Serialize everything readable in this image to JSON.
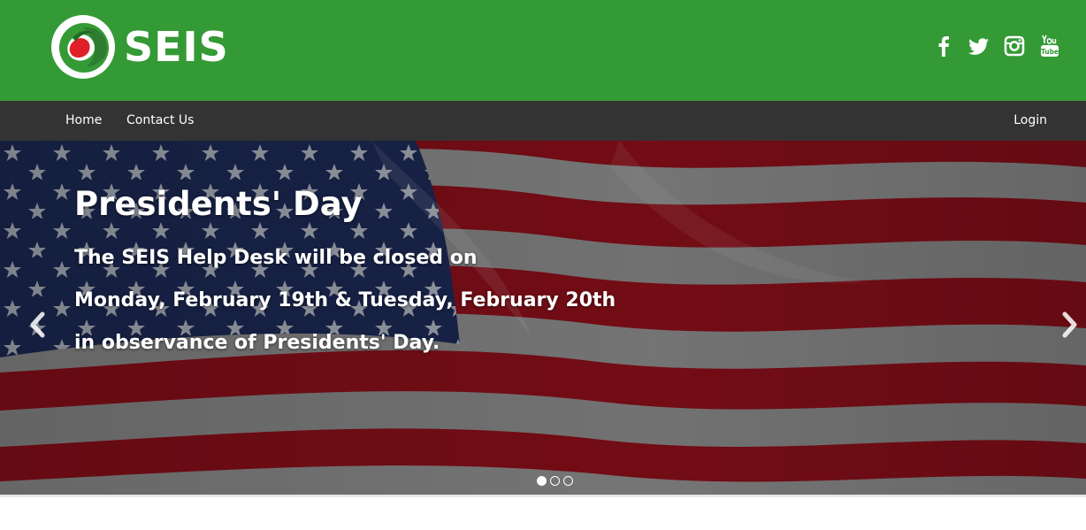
{
  "header": {
    "brand": "SEIS",
    "background_color": "#349a35",
    "social_icons": [
      "facebook-icon",
      "twitter-icon",
      "instagram-icon",
      "youtube-icon"
    ]
  },
  "nav": {
    "background_color": "#333333",
    "items": [
      {
        "label": "Home"
      },
      {
        "label": "Contact Us"
      }
    ],
    "login_label": "Login"
  },
  "carousel": {
    "title": "Presidents' Day",
    "lines": [
      "The SEIS Help Desk will be closed on",
      "Monday, February 19th & Tuesday, February 20th",
      "in observance of Presidents' Day."
    ],
    "slide_count": 3,
    "active_slide": 1,
    "prev_icon": "chevron-left-icon",
    "next_icon": "chevron-right-icon"
  }
}
